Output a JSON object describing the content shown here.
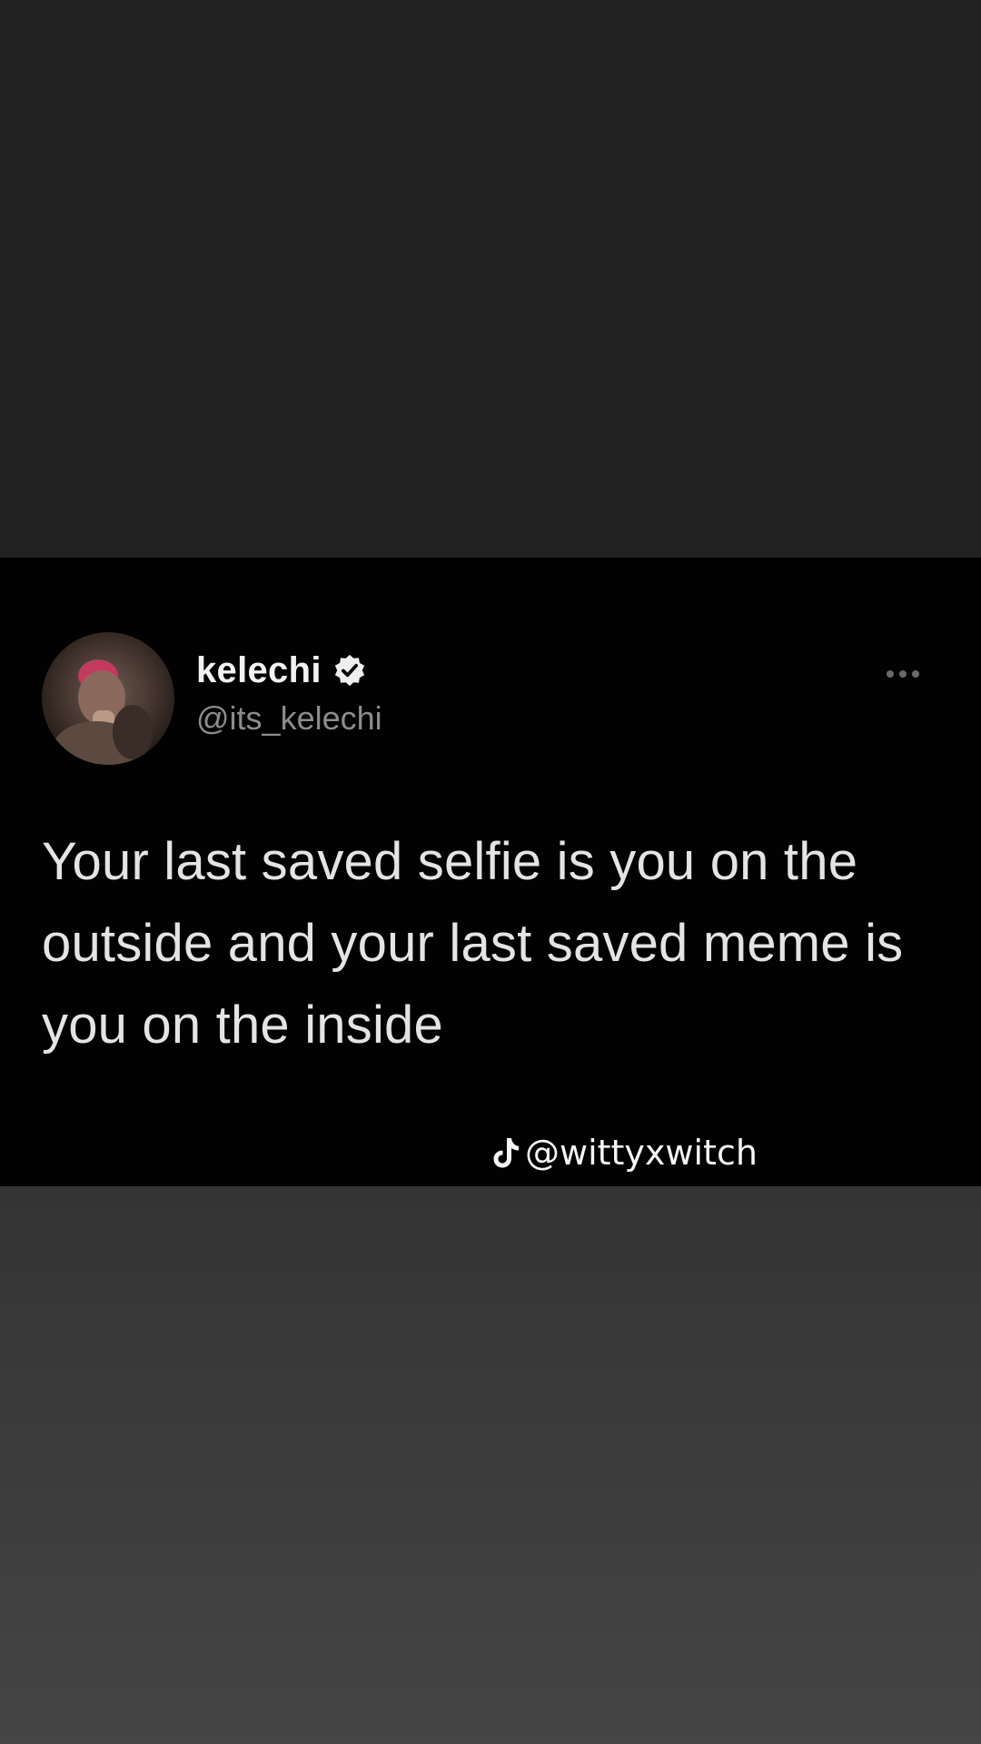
{
  "tweet": {
    "display_name": "kelechi",
    "handle": "@its_kelechi",
    "verified": true,
    "text": "Your last saved selfie is you on the outside and your last saved meme is you on the inside",
    "icons": {
      "avatar": "profile-photo",
      "verified": "verified-badge-icon",
      "more": "more-options-icon"
    }
  },
  "watermark": {
    "icon": "tiktok-icon",
    "text": "@wittyxwitch"
  },
  "colors": {
    "card_background": "#020202",
    "page_background_top": "#212121",
    "page_background_bottom": "#444444",
    "text_primary": "#f2f2f2",
    "text_secondary": "#8c8c8c"
  }
}
